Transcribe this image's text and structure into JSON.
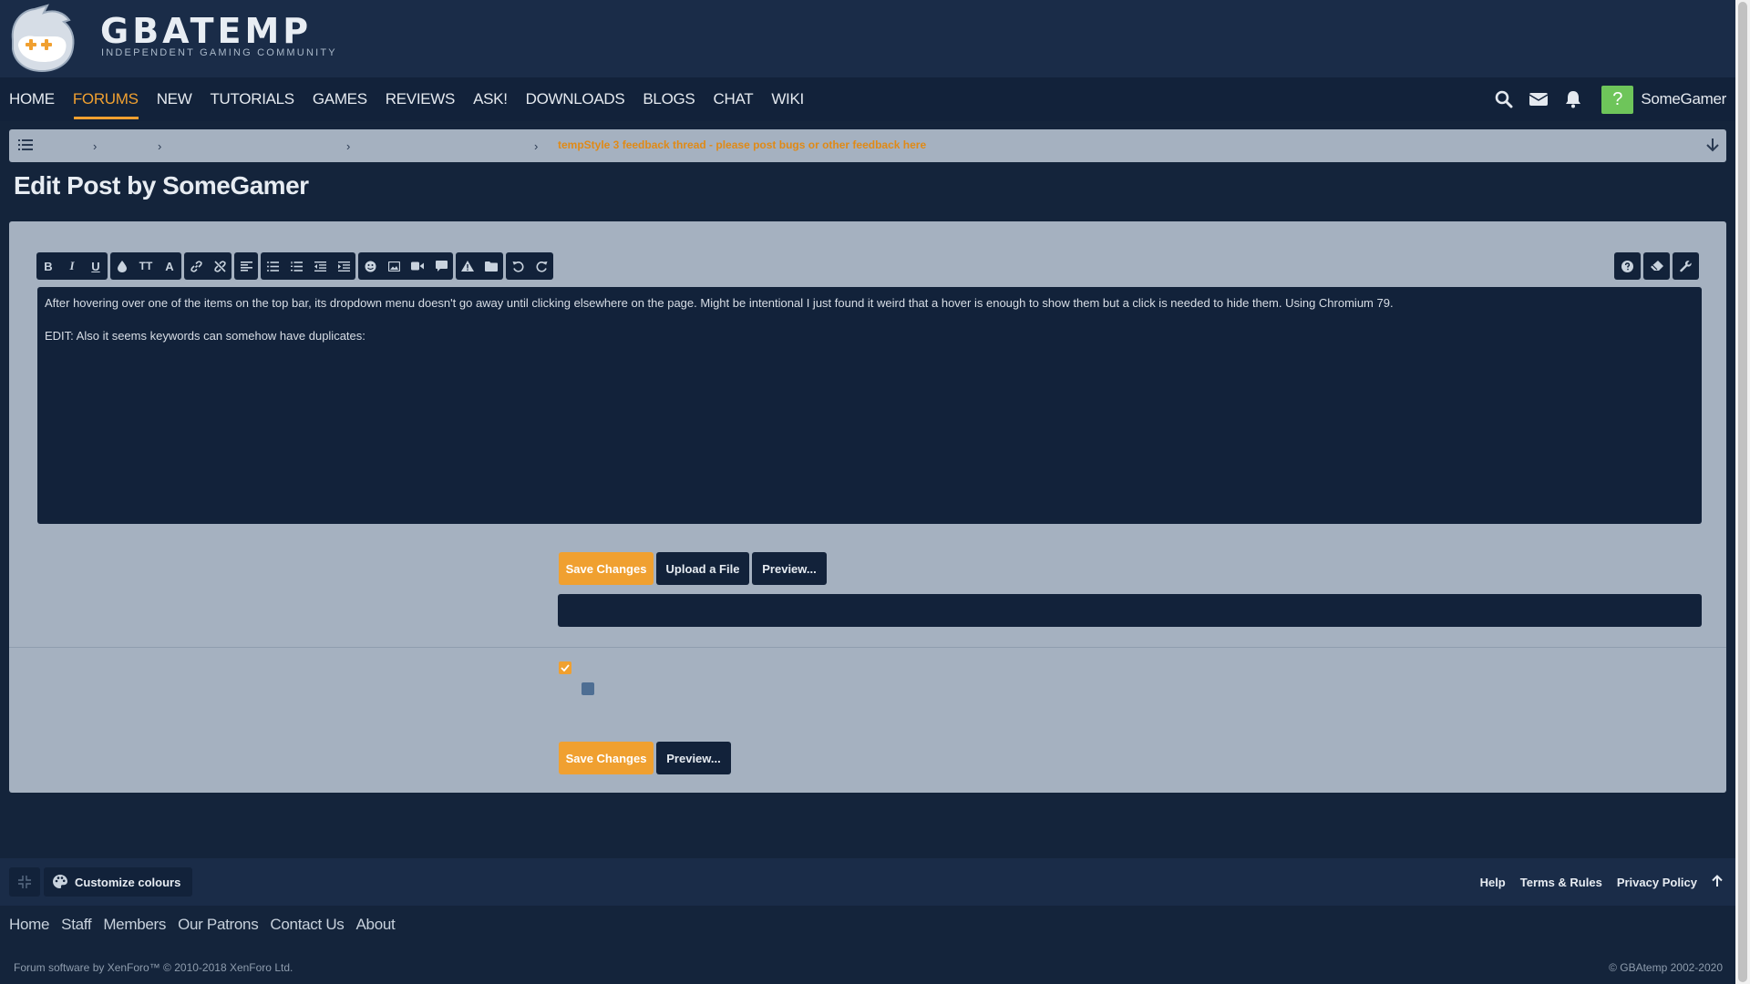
{
  "header": {
    "brand": "GBATEMP",
    "tagline": "INDEPENDENT GAMING COMMUNITY"
  },
  "nav": {
    "tabs": [
      {
        "label": "HOME"
      },
      {
        "label": "FORUMS"
      },
      {
        "label": "NEW"
      },
      {
        "label": "TUTORIALS"
      },
      {
        "label": "GAMES"
      },
      {
        "label": "REVIEWS"
      },
      {
        "label": "ASK!"
      },
      {
        "label": "DOWNLOADS"
      },
      {
        "label": "BLOGS"
      },
      {
        "label": "CHAT"
      },
      {
        "label": "WIKI"
      }
    ],
    "active_tab": "FORUMS",
    "avatar_letter": "?",
    "username": "SomeGamer"
  },
  "breadcrumb": {
    "current": "tempStyle 3 feedback thread - please post bugs or other feedback here"
  },
  "page": {
    "title": "Edit Post by SomeGamer"
  },
  "editor": {
    "paragraphs": [
      "After hovering over one of the items on the top bar, its dropdown menu doesn't go away until clicking elsewhere on the page. Might be intentional I just found it weird that a hover is enough to show them but a click is needed to hide them. Using Chromium 79.",
      "EDIT: Also it seems keywords can somehow have duplicates:"
    ]
  },
  "toolbar": {
    "bold": "B",
    "italic": "I",
    "underline": "U",
    "font_size": "TT",
    "font": "A"
  },
  "actions": {
    "save": "Save Changes",
    "upload": "Upload a File",
    "preview": "Preview..."
  },
  "footer": {
    "customize": "Customize colours",
    "links": [
      "Help",
      "Terms & Rules",
      "Privacy Policy"
    ],
    "nav": [
      "Home",
      "Staff",
      "Members",
      "Our Patrons",
      "Contact Us",
      "About"
    ],
    "copyright_left": "Forum software by XenForo™ © 2010-2018 XenForo Ltd.",
    "copyright_right": "© GBAtemp 2002-2020"
  },
  "colors": {
    "accent": "#f0a030",
    "background": "#14243b",
    "panel": "#a5b1c0",
    "dark": "#12223a",
    "avatar": "#6ec55a"
  }
}
